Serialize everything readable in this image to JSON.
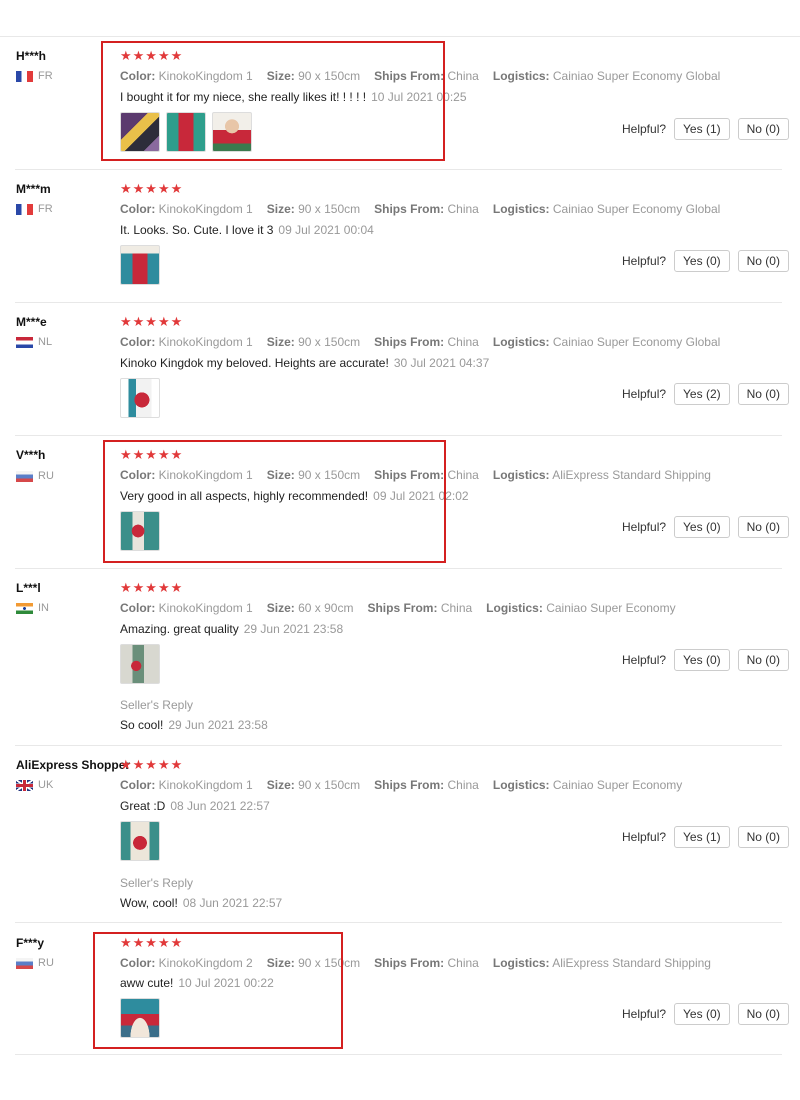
{
  "labels": {
    "color": "Color:",
    "size": "Size:",
    "ships": "Ships From:",
    "logistics": "Logistics:",
    "helpful": "Helpful?",
    "seller_reply": "Seller's Reply"
  },
  "colors": {
    "star": "#e1393a",
    "highlight_box": "#d42020"
  },
  "reviews": [
    {
      "user": "H***h",
      "country": "FR",
      "flag": "flag-fr-icon",
      "stars": "★★★★★",
      "color": "KinokoKingdom 1",
      "size": "90 x 150cm",
      "ships": "China",
      "logistics": "Cainiao Super Economy Global",
      "text": "I bought it for my niece, she really likes it! ! ! ! !",
      "date": "10 Jul 2021 00:25",
      "yes": "Yes (1)",
      "no": "No (0)",
      "highlighted": true,
      "photos": 3
    },
    {
      "user": "M***m",
      "country": "FR",
      "flag": "flag-fr-icon",
      "stars": "★★★★★",
      "color": "KinokoKingdom 1",
      "size": "90 x 150cm",
      "ships": "China",
      "logistics": "Cainiao Super Economy Global",
      "text": "It. Looks. So. Cute. I love it 3",
      "date": "09 Jul 2021 00:04",
      "yes": "Yes (0)",
      "no": "No (0)",
      "highlighted": false,
      "photos": 1
    },
    {
      "user": "M***e",
      "country": "NL",
      "flag": "flag-nl-icon",
      "stars": "★★★★★",
      "color": "KinokoKingdom 1",
      "size": "90 x 150cm",
      "ships": "China",
      "logistics": "Cainiao Super Economy Global",
      "text": "Kinoko Kingdok my beloved. Heights are accurate!",
      "date": "30 Jul 2021 04:37",
      "yes": "Yes (2)",
      "no": "No (0)",
      "highlighted": false,
      "photos": 1
    },
    {
      "user": "V***h",
      "country": "RU",
      "flag": "flag-ru-icon",
      "stars": "★★★★★",
      "color": "KinokoKingdom 1",
      "size": "90 x 150cm",
      "ships": "China",
      "logistics": "AliExpress Standard Shipping",
      "text": "Very good in all aspects, highly recommended!",
      "date": "09 Jul 2021 02:02",
      "yes": "Yes (0)",
      "no": "No (0)",
      "highlighted": true,
      "photos": 1
    },
    {
      "user": "L***l",
      "country": "IN",
      "flag": "flag-in-icon",
      "stars": "★★★★★",
      "color": "KinokoKingdom 1",
      "size": "60 x 90cm",
      "ships": "China",
      "logistics": "Cainiao Super Economy",
      "text": "Amazing. great quality",
      "date": "29 Jun 2021 23:58",
      "seller_text": "So cool!",
      "seller_date": "29 Jun 2021 23:58",
      "yes": "Yes (0)",
      "no": "No (0)",
      "highlighted": false,
      "photos": 1
    },
    {
      "user": "AliExpress Shopper",
      "country": "UK",
      "flag": "flag-uk-icon",
      "stars": "★★★★★",
      "color": "KinokoKingdom 1",
      "size": "90 x 150cm",
      "ships": "China",
      "logistics": "Cainiao Super Economy",
      "text": "Great :D",
      "date": "08 Jun 2021 22:57",
      "seller_text": "Wow, cool!",
      "seller_date": "08 Jun 2021 22:57",
      "yes": "Yes (1)",
      "no": "No (0)",
      "highlighted": false,
      "photos": 1
    },
    {
      "user": "F***y",
      "country": "RU",
      "flag": "flag-ru-icon",
      "stars": "★★★★★",
      "color": "KinokoKingdom 2",
      "size": "90 x 150cm",
      "ships": "China",
      "logistics": "AliExpress Standard Shipping",
      "text": "aww cute!",
      "date": "10 Jul 2021 00:22",
      "yes": "Yes (0)",
      "no": "No (0)",
      "highlighted": true,
      "photos": 1
    }
  ]
}
